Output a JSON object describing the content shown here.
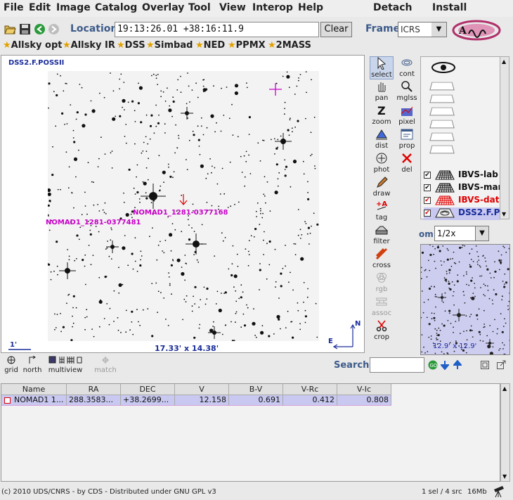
{
  "menu": {
    "items": [
      "File",
      "Edit",
      "Image",
      "Catalog",
      "Overlay",
      "Tool",
      "View",
      "Interop",
      "Help"
    ],
    "detach": "Detach",
    "install": "Install"
  },
  "toolbar": {
    "location_label": "Location",
    "location_value": "19:13:26.01 +38:16:11.9",
    "clear_label": "Clear",
    "frame_label": "Frame",
    "frame_value": "ICRS"
  },
  "bookmarks": [
    "Allsky opt",
    "Allsky IR",
    "DSS",
    "Simbad",
    "NED",
    "PPMX",
    "2MASS"
  ],
  "view": {
    "survey": "DSS2.F.POSSII",
    "source_label_1": "NOMAD1_1281-0377168",
    "source_label_2": "NOMAD1_1281-0377481",
    "fov": "17.33' x 14.38'",
    "scale": "1'",
    "compass_n": "N",
    "compass_e": "E"
  },
  "tools": [
    {
      "id": "select",
      "label": "select",
      "icon": "pointer-icon"
    },
    {
      "id": "cont",
      "label": "cont",
      "icon": "contour-icon"
    },
    {
      "id": "pan",
      "label": "pan",
      "icon": "hand-icon"
    },
    {
      "id": "mglss",
      "label": "mglss",
      "icon": "magnifier-icon"
    },
    {
      "id": "zoom",
      "label": "zoom",
      "icon": "zoom-icon"
    },
    {
      "id": "pixel",
      "label": "pixel",
      "icon": "pixel-icon"
    },
    {
      "id": "dist",
      "label": "dist",
      "icon": "distance-icon"
    },
    {
      "id": "prop",
      "label": "prop",
      "icon": "properties-icon"
    },
    {
      "id": "phot",
      "label": "phot",
      "icon": "photometry-icon"
    },
    {
      "id": "del",
      "label": "del",
      "icon": "delete-icon"
    },
    {
      "id": "draw",
      "label": "draw",
      "icon": "pencil-icon"
    },
    {
      "id": "tag",
      "label": "tag",
      "icon": "tag-icon"
    },
    {
      "id": "filter",
      "label": "filter",
      "icon": "filter-icon"
    },
    {
      "id": "cross",
      "label": "cross",
      "icon": "crossmatch-icon"
    },
    {
      "id": "rgb",
      "label": "rgb",
      "icon": "rgb-icon"
    },
    {
      "id": "assoc",
      "label": "assoc",
      "icon": "assoc-icon"
    },
    {
      "id": "crop",
      "label": "crop",
      "icon": "scissors-icon"
    }
  ],
  "stack": {
    "layers": [
      {
        "label": "IBVS-lab",
        "color": "#111111",
        "checked": true
      },
      {
        "label": "IBVS-mar",
        "color": "#111111",
        "checked": true
      },
      {
        "label": "IBVS-dat",
        "color": "#e00000",
        "checked": true
      },
      {
        "label": "DSS2.F.P",
        "color": "#1a2d9a",
        "checked": true
      }
    ]
  },
  "zoom": {
    "label": "om",
    "value": "1/2x",
    "thumb_fov": "12.9' x 12.9'"
  },
  "bottom_tools": {
    "grid": "grid",
    "north": "north",
    "multiview": "multiview",
    "match": "match",
    "search_label": "Search"
  },
  "table": {
    "columns": [
      "Name",
      "RA",
      "DEC",
      "V",
      "B-V",
      "V-Rc",
      "V-Ic"
    ],
    "rows": [
      [
        "NOMAD1 1...",
        "288.3583...",
        "+38.2699...",
        "12.158",
        "0.691",
        "0.412",
        "0.808"
      ]
    ]
  },
  "status": {
    "left": "(c) 2010 UDS/CNRS - by CDS - Distributed under GNU GPL v3",
    "selection": "1 sel / 4 src",
    "memory": "16Mb"
  },
  "colors": {
    "accent": "#3d5b8a",
    "label_magenta": "#c800c8",
    "selected_row": "#c8c8f0"
  }
}
